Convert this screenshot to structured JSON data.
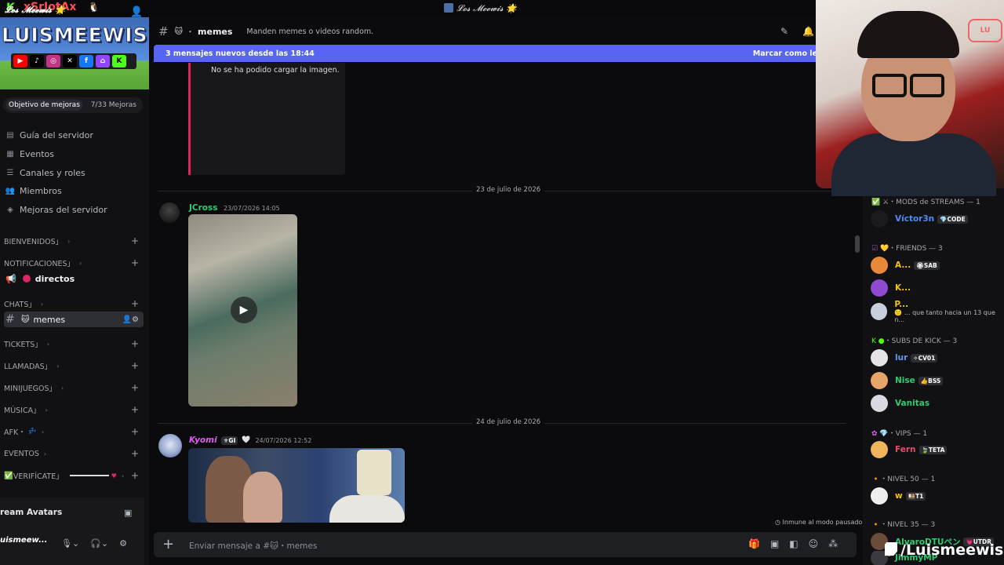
{
  "topbar": {
    "streamer": "xSrJotAx",
    "server_title": "𝓛𝓸𝓼 𝓜𝓮𝓮𝔀𝓲𝓼 🌟"
  },
  "sidebar": {
    "banner_title": "𝓛𝓸𝓼 𝓜𝓮𝓮𝔀𝓲𝓼 🌟",
    "banner_logo": "LUISMEEWIS",
    "boost_label": "Objetivo de mejoras",
    "boost_count": "7/33 Mejoras",
    "nav": [
      "Guía del servidor",
      "Eventos",
      "Canales y roles",
      "Miembros",
      "Mejoras del servidor"
    ],
    "categories": {
      "bienvenidos": "BIENVENIDOS」",
      "notificaciones": "NOTIFICACIONES」",
      "chats": "CHATS」",
      "tickets": "TICKETS」",
      "llamadas": "LLAMADAS」",
      "minijuegos": "MINIJUEGOS」",
      "musica": "MÚSICA」",
      "afk": "AFK・",
      "eventos": "EVENTOS",
      "verificate": "VERIFÍCATE」"
    },
    "channels": {
      "directos": "directos",
      "memes": "memes"
    },
    "stream_avatars": "ream Avatars",
    "user_name": "uismeew..."
  },
  "header": {
    "channel": "memes",
    "topic": "Manden memes o videos random."
  },
  "newbar": {
    "text": "3 mensajes nuevos desde las 18:44",
    "action": "Marcar como le"
  },
  "messages": {
    "embed_error": "No se ha podido cargar la imagen.",
    "day1": "23 de julio de 2026",
    "msg1_author": "JCross",
    "msg1_time": "23/07/2026 14:05",
    "day2": "24 de julio de 2026",
    "msg2_author": "Kyomi",
    "msg2_tag": "GI",
    "msg2_time": "24/07/2026 12:52"
  },
  "composer": {
    "placeholder": "Enviar mensaje a #🐱・memes",
    "slowmode": "Inmune al modo pausado"
  },
  "members": {
    "groups": {
      "mods": "・MODS de STREAMS — 1",
      "friends": "・FRIENDS — 3",
      "subs": "・SUBS DE KICK — 3",
      "vips": "・VIPS — 1",
      "nivel50": "・NIVEL 50 — 1",
      "nivel35": "・NIVEL 35 — 3"
    },
    "list": {
      "victor": {
        "name": "Víctor3n",
        "badge": "CODE"
      },
      "a": {
        "name": "A...",
        "badge": "SAB"
      },
      "k": {
        "name": "K..."
      },
      "p": {
        "name": "P...",
        "status": "... que tanto hacia un 13 que n..."
      },
      "lur": {
        "name": "lur",
        "badge": "CV01"
      },
      "nise": {
        "name": "Nise",
        "badge": "BSS"
      },
      "vanitas": {
        "name": "Vanitas"
      },
      "fern": {
        "name": "Fern",
        "badge": "TETA"
      },
      "w": {
        "name": "w",
        "badge": "T1"
      },
      "alvaro": {
        "name": "AlvaroDTUペン",
        "badge": "UTDR"
      },
      "jimmy": {
        "name": "JimmyMP"
      }
    }
  },
  "overlay": {
    "twitch_handle": "/Luismeewis",
    "yt_logo": "LU"
  }
}
